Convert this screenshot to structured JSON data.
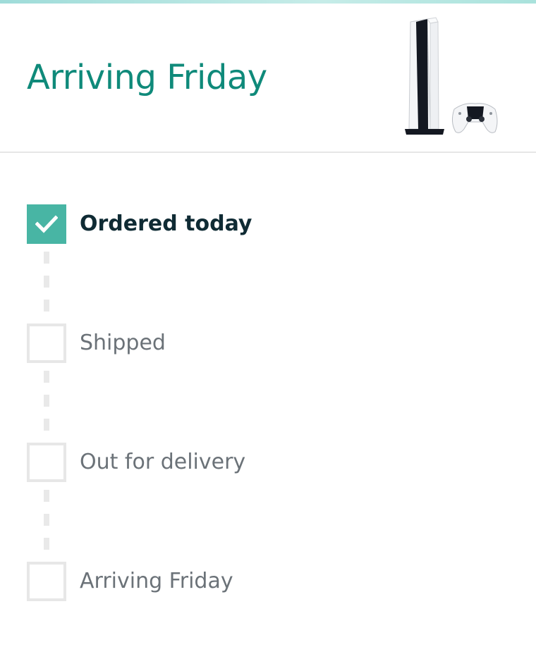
{
  "header": {
    "arrival_title": "Arriving Friday"
  },
  "product": {
    "image_icon": "game-console-with-controller",
    "image_colors": {
      "console_white": "#f4f5f7",
      "console_black": "#141821"
    }
  },
  "timeline": {
    "steps": [
      {
        "label": "Ordered today",
        "completed": true
      },
      {
        "label": "Shipped",
        "completed": false
      },
      {
        "label": "Out for delivery",
        "completed": false
      },
      {
        "label": "Arriving Friday",
        "completed": false
      }
    ]
  },
  "colors": {
    "accent_teal": "#0f8a7a",
    "check_teal": "#48b5a4",
    "muted_text": "#6b7278",
    "dark_text": "#0f2b34"
  }
}
